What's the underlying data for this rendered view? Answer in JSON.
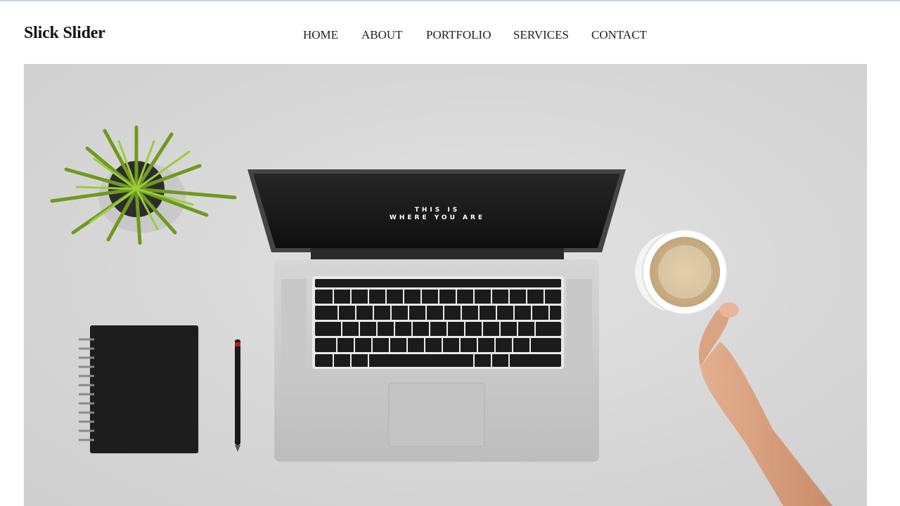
{
  "header": {
    "logo": "Slick Slider"
  },
  "nav": {
    "items": [
      {
        "label": "HOME"
      },
      {
        "label": "ABOUT"
      },
      {
        "label": "PORTFOLIO"
      },
      {
        "label": "SERVICES"
      },
      {
        "label": "CONTACT"
      }
    ]
  },
  "slider": {
    "current_slide": {
      "description_icon": "desk-workspace-photo",
      "screen_text_line1": "THIS IS",
      "screen_text_line2": "WHERE YOU ARE"
    }
  },
  "colors": {
    "background": "#ffffff",
    "desk": "#d8d8d8",
    "text": "#111111",
    "top_rule": "#c9d6e3"
  }
}
